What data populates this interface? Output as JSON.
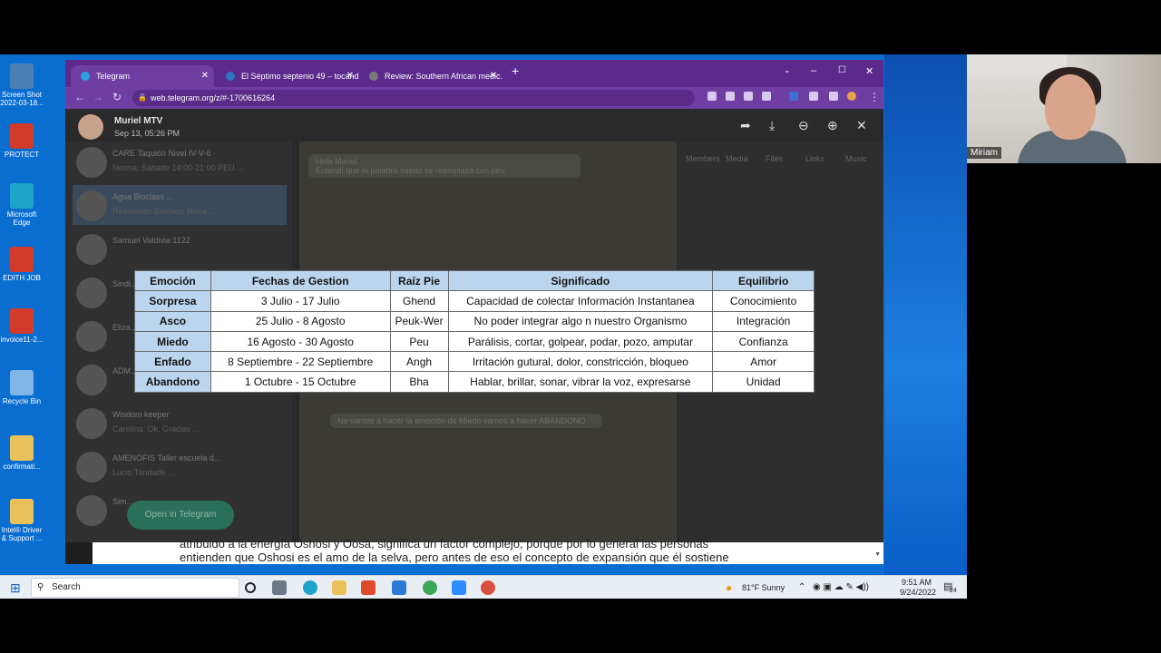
{
  "desktop": {
    "icons": [
      {
        "label": "Screen Shot 2022-03-18...",
        "color": "#4a7fb5"
      },
      {
        "label": "PROTECT",
        "color": "#d23a2c"
      },
      {
        "label": "Microsoft Edge",
        "color": "#1ea4c8"
      },
      {
        "label": "EDITH JOB",
        "color": "#d23a2c"
      },
      {
        "label": "invoice11-2...",
        "color": "#d23a2c"
      },
      {
        "label": "Recycle Bin",
        "color": "#7fb6e6"
      },
      {
        "label": "confirmati...",
        "color": "#e8c15a"
      },
      {
        "label": "Intel® Driver & Support ...",
        "color": "#e8c15a"
      }
    ]
  },
  "browser": {
    "tabs": [
      {
        "title": "Telegram",
        "active": true,
        "favicon_color": "#2aa3e0"
      },
      {
        "title": "El Séptimo septenio 49 – tocand...",
        "active": false,
        "favicon_color": "#2f74c0"
      },
      {
        "title": "Review: Southern African medic...",
        "active": false,
        "favicon_color": "#7a7a7a"
      }
    ],
    "url": "web.telegram.org/z/#-1700616264"
  },
  "viewer": {
    "sender_name": "Muriel MTV",
    "sender_date": "Sep 13, 05:26 PM",
    "background_chats": [
      {
        "name": "CARE Taquión Nivel IV-V-6",
        "preview": "Norma: Sábado 14:00-21:00 PEU ..."
      },
      {
        "name": "Agua Bioclass ...",
        "preview": "Reenviado Bioclass Maria ..."
      },
      {
        "name": "Samuel Valdivia 1122",
        "preview": ""
      },
      {
        "name": "Sindi...",
        "preview": ""
      },
      {
        "name": "Eliza...",
        "preview": ""
      },
      {
        "name": "ADM...",
        "preview": ""
      },
      {
        "name": "Wisdom keeper",
        "preview": "Carolina: Ok, Gracias ..."
      },
      {
        "name": "AMENOFIS Taller escuela d...",
        "preview": "Lucio Tandade ..."
      },
      {
        "name": "Sim...",
        "preview": ""
      }
    ],
    "background_messages": [
      "Hola Muriel,",
      "Entendí que la palabra miedo se reemplaza con peu",
      "No vamos a hacer la emoción de Miedo vamos a hacer ABANDONO"
    ],
    "background_tabs": [
      "Members",
      "Media",
      "Files",
      "Links",
      "Music"
    ],
    "open_button_label": "Open in Telegram"
  },
  "slide_table": {
    "headers": [
      "Emoción",
      "Fechas de Gestion",
      "Raíz Pie",
      "Significado",
      "Equilibrio"
    ],
    "rows": [
      [
        "Sorpresa",
        "3 Julio - 17 Julio",
        "Ghend",
        "Capacidad de colectar Información Instantanea",
        "Conocimiento"
      ],
      [
        "Asco",
        "25 Julio - 8 Agosto",
        "Peuk-Wer",
        "No poder integrar algo n nuestro Organismo",
        "Integración"
      ],
      [
        "Miedo",
        "16 Agosto - 30 Agosto",
        "Peu",
        "Parálisis, cortar, golpear, podar, pozo, amputar",
        "Confianza"
      ],
      [
        "Enfado",
        "8 Septiembre - 22 Septiembre",
        "Angh",
        "Irritación gutural, dolor, constricción, bloqueo",
        "Amor"
      ],
      [
        "Abandono",
        "1 Octubre - 15 Octubre",
        "Bha",
        "Hablar, brillar, sonar, vibrar la voz, expresarse",
        "Unidad"
      ]
    ]
  },
  "captions": [
    "atribuido a la energía Oshosi y Oosa, significa un factor complejo, porque por lo general las personas",
    "entienden que Oshosi es el amo de la selva, pero antes de eso el concepto de expansión que él sostiene"
  ],
  "taskbar": {
    "search_label": "Search",
    "weather": "81°F  Sunny",
    "time": "9:51 AM",
    "date": "9/24/2022",
    "notification_count": "24"
  },
  "webcam": {
    "participant_name": "Miriam"
  }
}
